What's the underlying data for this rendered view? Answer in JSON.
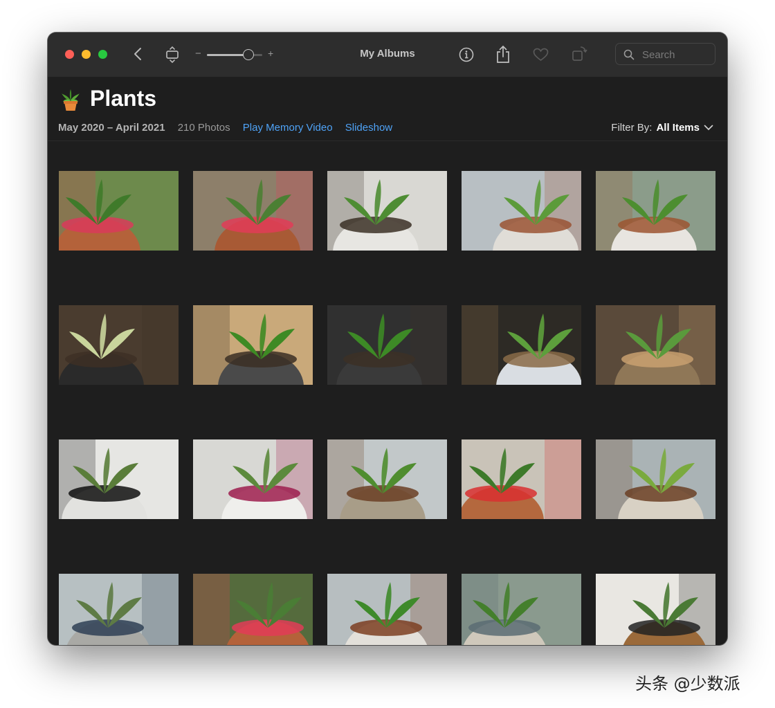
{
  "window": {
    "title": "My Albums",
    "search_placeholder": "Search",
    "zoom_level": 0.75
  },
  "toolbar": {
    "icons": [
      "back-chevron-icon",
      "fit-window-icon",
      "info-icon",
      "share-icon",
      "heart-icon",
      "rotate-icon",
      "search-icon"
    ]
  },
  "album": {
    "emoji_icon": "potted-plant-icon",
    "title": "Plants",
    "date_range": "May 2020 – April 2021",
    "photo_count": "210 Photos",
    "play_memory_label": "Play Memory Video",
    "slideshow_label": "Slideshow",
    "filter_label": "Filter By:",
    "filter_value": "All Items"
  },
  "watermark": "头条 @少数派",
  "colors": {
    "window_bg": "#1e1e1e",
    "titlebar_bg": "#2d2d2d",
    "link": "#4fa3f7",
    "close": "#fe5f57",
    "minimize": "#febc2e",
    "maximize": "#28c840"
  },
  "photos": [
    {
      "subject": "red-flower-cactus",
      "bg": "#6d8a4c",
      "pot": "#b4623a",
      "leaf": "#3f7a2a",
      "accent": "#d93b5a"
    },
    {
      "subject": "cactus-with-clay-balls",
      "bg": "#8d7f6a",
      "pot": "#a85a35",
      "leaf": "#4b7f33",
      "accent": "#e23c57"
    },
    {
      "subject": "white-pot-seedling",
      "bg": "#d9d8d3",
      "pot": "#e7e6e2",
      "leaf": "#4e8d33",
      "accent": "#3b3026"
    },
    {
      "subject": "window-tomato-seedling",
      "bg": "#b8bfc3",
      "pot": "#e0ddd7",
      "leaf": "#5c9b3a",
      "accent": "#9a5434"
    },
    {
      "subject": "balcony-seedling",
      "bg": "#8b9c8a",
      "pot": "#e8e5e0",
      "leaf": "#4d8e30",
      "accent": "#9c5530"
    },
    {
      "subject": "black-pot-sprout",
      "bg": "#4a3c2f",
      "pot": "#2a2a2a",
      "leaf": "#c9d59c",
      "accent": "#3d2f24"
    },
    {
      "subject": "grey-pot-seedling",
      "bg": "#c9a97a",
      "pot": "#4a4a4a",
      "leaf": "#3e8a24",
      "accent": "#3b2f25"
    },
    {
      "subject": "coffee-plant-pot",
      "bg": "#303030",
      "pot": "#3a3a3a",
      "leaf": "#3d8a26",
      "accent": "#3c3026"
    },
    {
      "subject": "basket-plants",
      "bg": "#2d2a25",
      "pot": "#d9dde2",
      "leaf": "#5d9f3c",
      "accent": "#8a6b48"
    },
    {
      "subject": "wicker-basket-plant",
      "bg": "#5a4a3a",
      "pot": "#8f7757",
      "leaf": "#5a9a3c",
      "accent": "#c9a070"
    },
    {
      "subject": "snake-plant",
      "bg": "#e6e6e3",
      "pot": "#e2e2df",
      "leaf": "#5a7d3a",
      "accent": "#111111"
    },
    {
      "subject": "white-pot-shrub",
      "bg": "#d8d8d4",
      "pot": "#efefec",
      "leaf": "#5c8a3c",
      "accent": "#9e1d4d"
    },
    {
      "subject": "window-plant-grey-pot",
      "bg": "#c2c8c9",
      "pot": "#a89d88",
      "leaf": "#4f8d2f",
      "accent": "#6b4024"
    },
    {
      "subject": "terracotta-pot-plant",
      "bg": "#c9c3b8",
      "pot": "#b4683e",
      "leaf": "#3d7a2a",
      "accent": "#d93030"
    },
    {
      "subject": "city-view-plant",
      "bg": "#aab3b5",
      "pot": "#d8d1c4",
      "leaf": "#7aaa3e",
      "accent": "#6b4024"
    },
    {
      "subject": "succulent-grey-pot",
      "bg": "#b7c0c2",
      "pot": "#a9a9a5",
      "leaf": "#5e7b45",
      "accent": "#2f3f55"
    },
    {
      "subject": "red-flower-cactus-2",
      "bg": "#556b3d",
      "pot": "#b4623a",
      "leaf": "#4a7d35",
      "accent": "#e23c57"
    },
    {
      "subject": "mulch-pot-seedling",
      "bg": "#b7bec0",
      "pot": "#e3e0da",
      "leaf": "#3e8a2a",
      "accent": "#7d3e21"
    },
    {
      "subject": "balcony-tomato",
      "bg": "#8a9a8e",
      "pot": "#cfc8bb",
      "leaf": "#447f2c",
      "accent": "#5b6c73"
    },
    {
      "subject": "living-room",
      "bg": "#e9e7e2",
      "pot": "#9b6a3a",
      "leaf": "#4a7a35",
      "accent": "#222222"
    }
  ]
}
